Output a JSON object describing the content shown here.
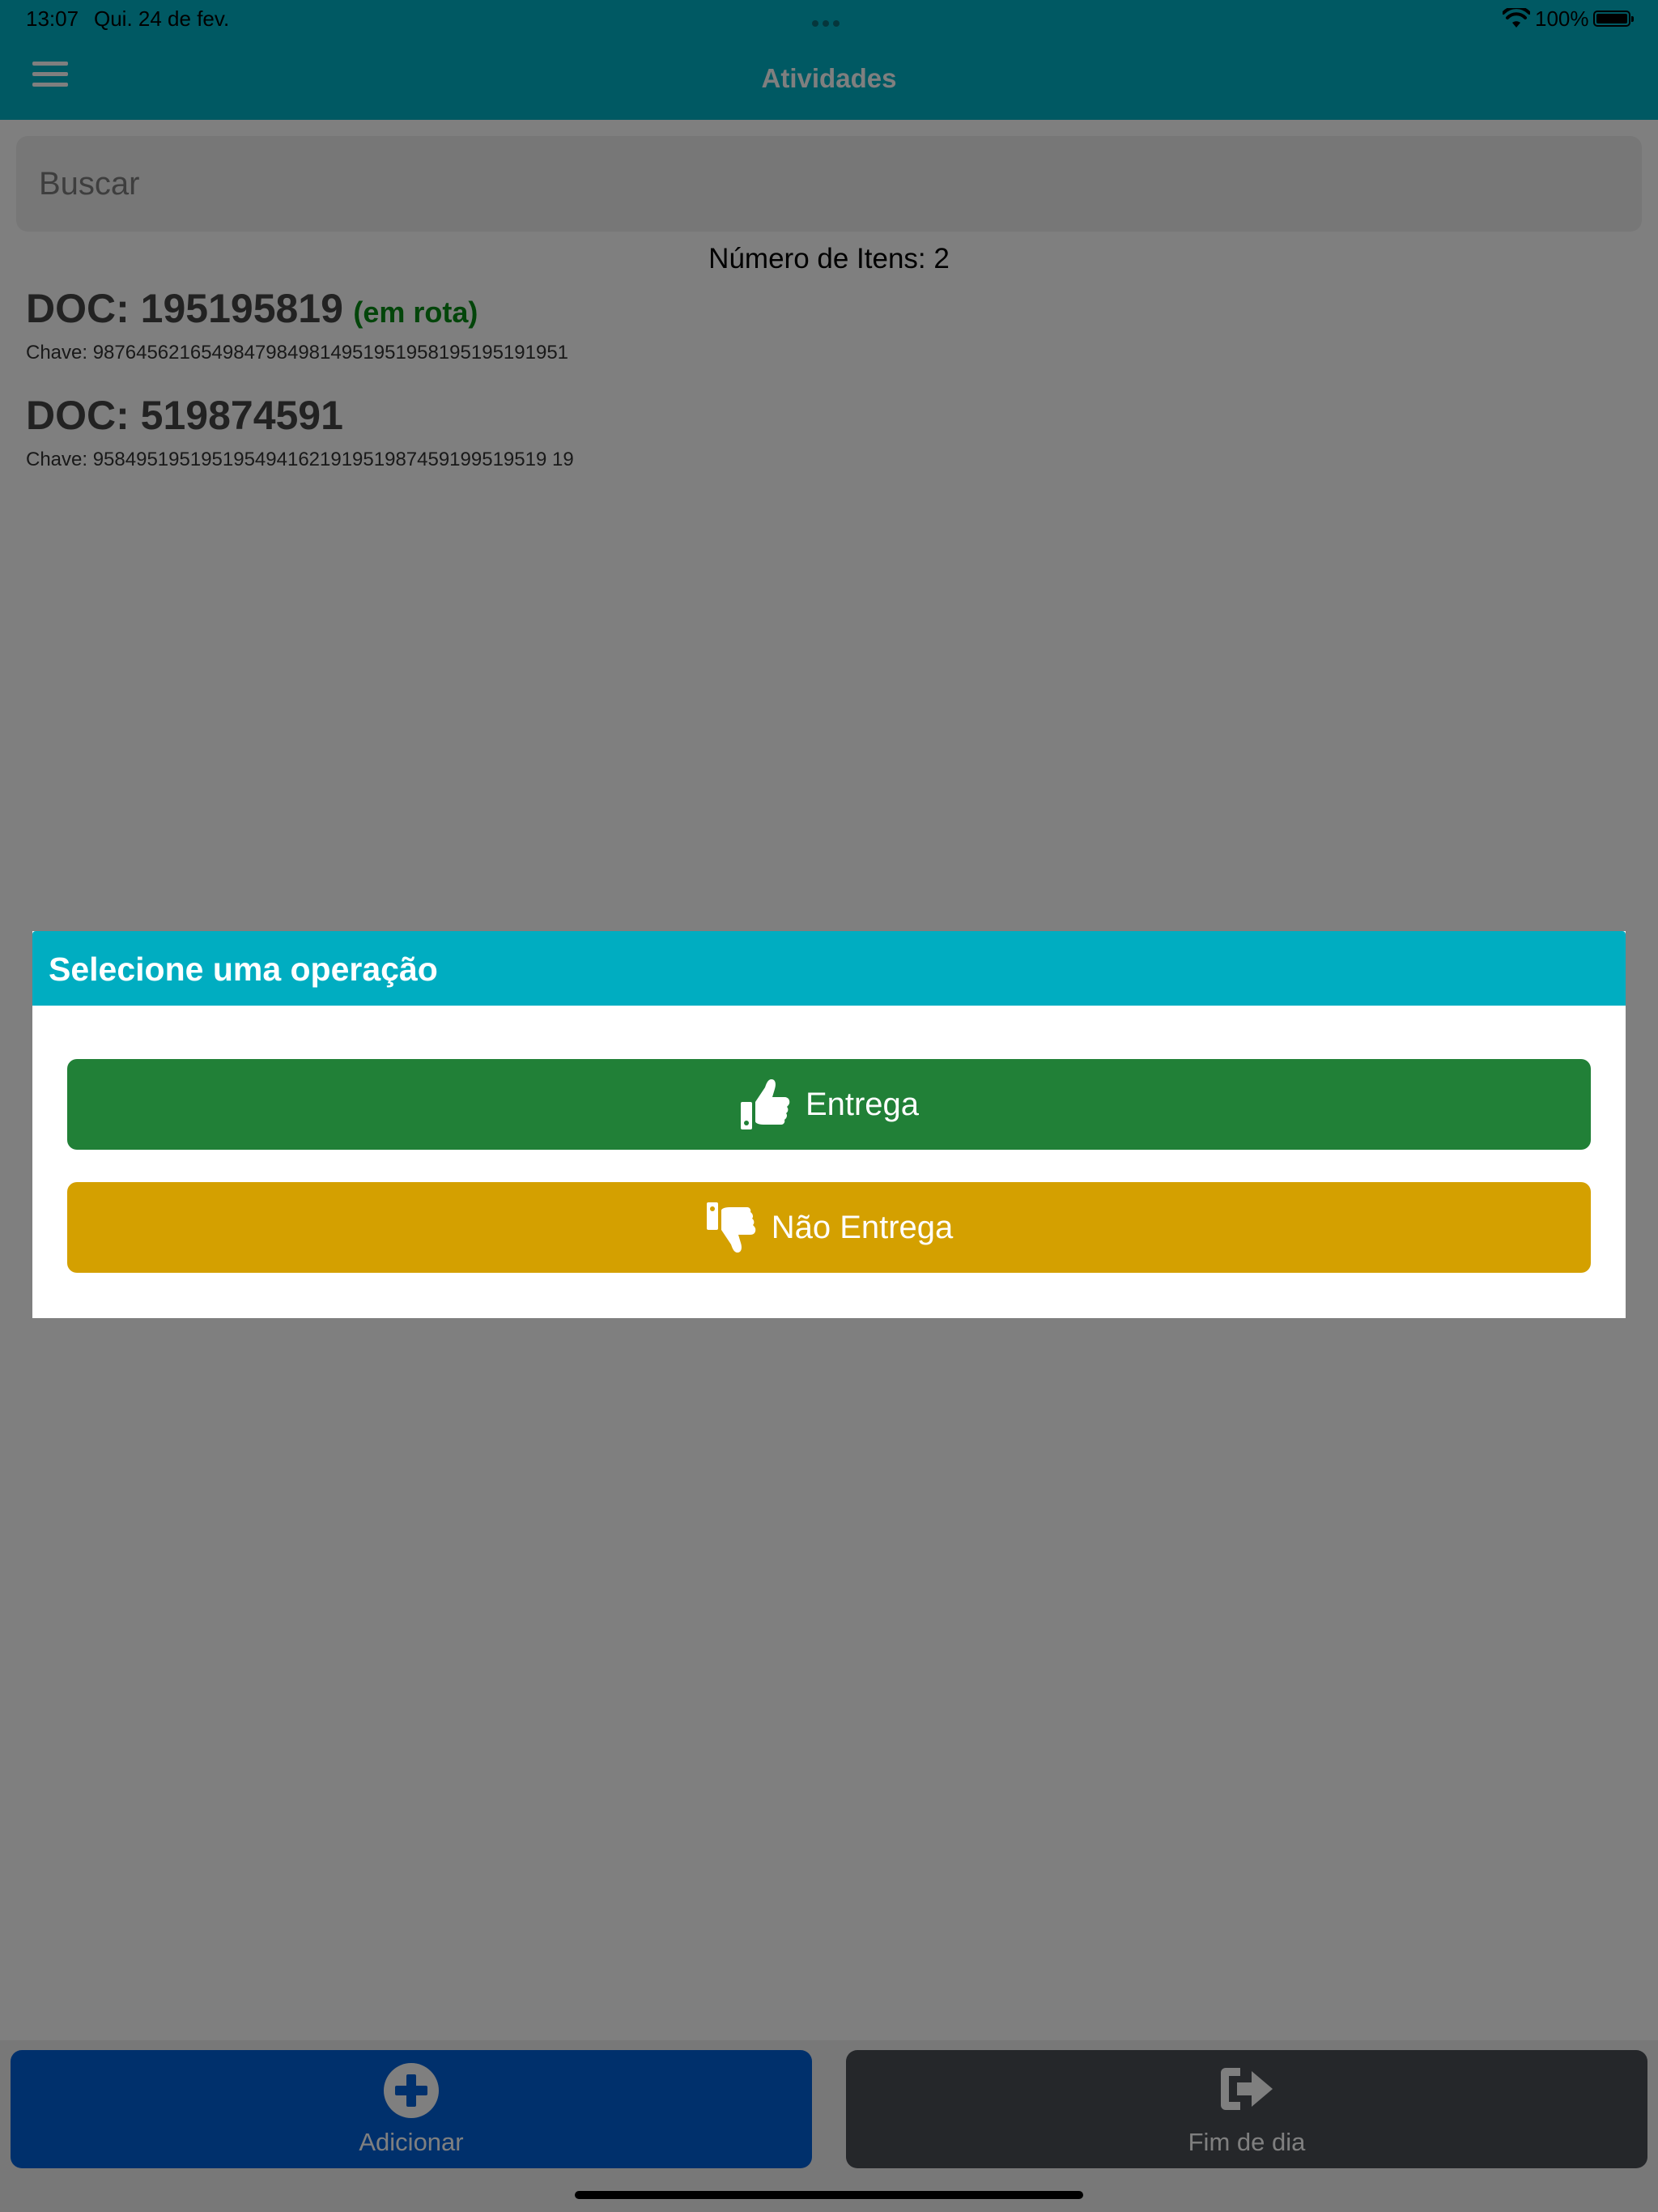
{
  "status_bar": {
    "time": "13:07",
    "date": "Qui. 24 de fev.",
    "battery": "100%"
  },
  "navbar": {
    "title": "Atividades",
    "menu_icon": "hamburger-menu-icon"
  },
  "search": {
    "placeholder": "Buscar",
    "value": ""
  },
  "list": {
    "count_text": "Número de Itens: 2",
    "items": [
      {
        "doc": "DOC: 195195819",
        "status": "(em rota)",
        "key": "Chave: 98764562165498479849814951951958195195191951"
      },
      {
        "doc": "DOC: 519874591",
        "status": "",
        "key": "Chave: 958495195195195494162191951987459199519519 19"
      }
    ]
  },
  "modal": {
    "title": "Selecione uma operação",
    "buttons": [
      {
        "label": "Entrega",
        "icon": "thumbs-up-icon",
        "color": "#218037"
      },
      {
        "label": "Não Entrega",
        "icon": "thumbs-down-icon",
        "color": "#d4a000"
      }
    ]
  },
  "footer": {
    "add_label": "Adicionar",
    "add_icon": "plus-circle-icon",
    "end_label": "Fim de dia",
    "end_icon": "sign-out-icon"
  },
  "colors": {
    "primary": "#00b3c6",
    "success": "#218037",
    "warning": "#d4a000",
    "add_button": "#0061d9",
    "end_button": "#4a4e55",
    "status_text": "#078b15"
  }
}
